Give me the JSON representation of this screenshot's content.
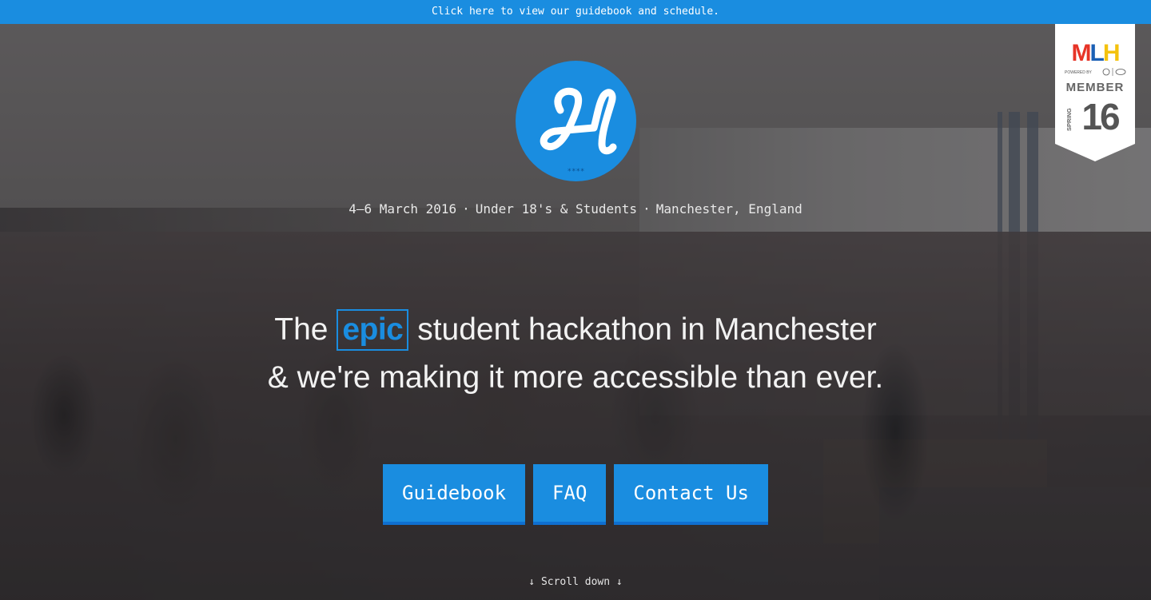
{
  "topbar": {
    "prefix": "Click ",
    "link_text": "here",
    "suffix": " to view our guidebook and schedule."
  },
  "badge": {
    "logo_text": "MLH",
    "powered_by": "POWERED BY",
    "member": "MEMBER",
    "season": "SPRING",
    "year": "16"
  },
  "logo": {
    "icon": "hack-manchester-logo-icon",
    "stars": "****"
  },
  "meta": {
    "date": "4–6 March 2016",
    "audience": "Under 18's & Students",
    "location": "Manchester, England",
    "separator": "·"
  },
  "headline": {
    "before": "The ",
    "highlight": "epic",
    "after": " student hackathon in Manchester",
    "line2": "& we're making it more accessible than ever."
  },
  "buttons": [
    {
      "label": "Guidebook"
    },
    {
      "label": "FAQ"
    },
    {
      "label": "Contact Us"
    }
  ],
  "scroll_hint": "↓ Scroll down ↓",
  "colors": {
    "accent": "#1a8de0",
    "accent_dark": "#0f6fd0",
    "text_light": "#f2f2f2"
  }
}
